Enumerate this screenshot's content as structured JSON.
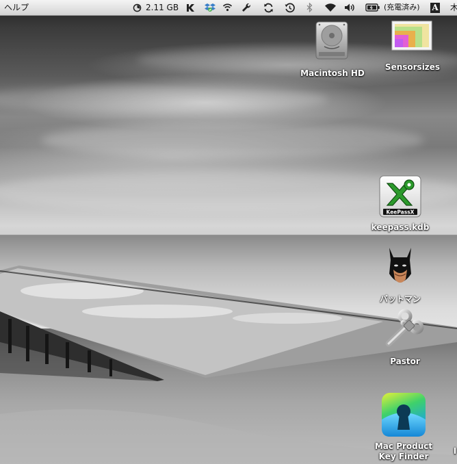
{
  "menubar": {
    "help_menu": "ヘルプ",
    "memory_text": "2.11 GB",
    "battery_status": "(充電済み)",
    "input_menu_label": "A",
    "clipped_item": "木"
  },
  "desktop": {
    "icons": [
      {
        "label": "Macintosh HD",
        "icon": "hard-drive-icon"
      },
      {
        "label": "Sensorsizes",
        "icon": "image-file-icon"
      },
      {
        "label": "keepass.kdb",
        "icon": "keepassx-icon"
      },
      {
        "label": "バットマン",
        "icon": "batman-icon"
      },
      {
        "label": "Pastor",
        "icon": "pastor-key-icon"
      },
      {
        "label_line1": "Mac Product",
        "label_line2": "Key Finder",
        "icon": "keyhole-app-icon"
      }
    ],
    "edge_label": "I"
  },
  "colors": {
    "menubar": "#e3e3e3",
    "keepass_green": "#2c9a2c",
    "keyfinder_cyan": "#2ab0e6",
    "keyfinder_yellow": "#e3f03a"
  }
}
